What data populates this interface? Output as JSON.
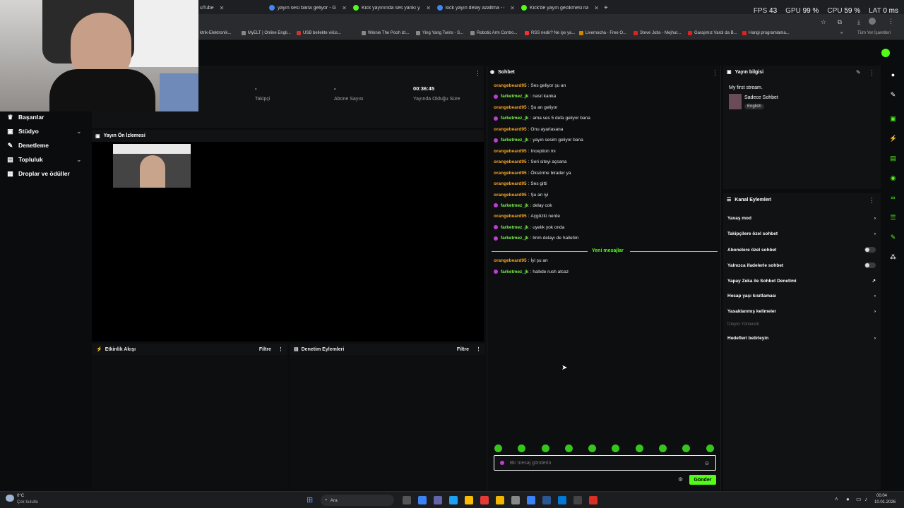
{
  "browser": {
    "tabs": [
      {
        "label": "uTube",
        "color": "#ff0000"
      },
      {
        "label": "yayın sesi bana geliyor - Googl",
        "color": "#4285f4"
      },
      {
        "label": "Kick yayınında ses yankı yapıyo",
        "color": "#53fc18"
      },
      {
        "label": "kick yayın delay azaltma - Goog",
        "color": "#4285f4"
      },
      {
        "label": "Kick'de yayın gecikmesi nasıl d",
        "color": "#53fc18"
      }
    ],
    "new_tab": "+",
    "bookmarks": [
      "ktrik-Elektronik...",
      "MyELT | Online Engli...",
      "USB bellekte virüs...",
      "Winnie The Pooh izl...",
      "Ying Yang Twins - S...",
      "Robotic Arm Contro...",
      "RSS nedir? Ne işe ya...",
      "Livemocha - Free O...",
      "Steve Jobs - Mejhur...",
      "Garajımız Vardı da B...",
      "Hangi programlama..."
    ],
    "all_bookmarks": "Tüm Yer İşaretleri"
  },
  "perf": {
    "fps_label": "FPS",
    "fps": "43",
    "gpu_label": "GPU",
    "gpu": "99 %",
    "cpu_label": "CPU",
    "cpu": "59 %",
    "lat_label": "LAT",
    "lat": "0 ms"
  },
  "sidebar": {
    "items": [
      {
        "label": "Başarılar",
        "icon": "trophy-icon"
      },
      {
        "label": "Stüdyo",
        "icon": "studio-icon"
      },
      {
        "label": "Denetleme",
        "icon": "shield-icon"
      },
      {
        "label": "Topluluk",
        "icon": "community-icon"
      },
      {
        "label": "Droplar ve ödüller",
        "icon": "gift-icon"
      }
    ]
  },
  "stats": {
    "followers_value": "-",
    "followers_label": "Takipçi",
    "subs_value": "-",
    "subs_label": "Abone Sayısı",
    "uptime_value": "00:36:45",
    "uptime_label": "Yayında Olduğu Süre"
  },
  "preview": {
    "title": "Yayın Ön İzlemesi"
  },
  "activity": {
    "title": "Etkinlik Akışı",
    "filter": "Filtre"
  },
  "moderation": {
    "title": "Denetim Eylemleri",
    "filter": "Filtre"
  },
  "chat": {
    "title": "Sohbet",
    "messages": [
      {
        "user": "orangebeard95",
        "type": "orange",
        "text": "Ses geliyor şu an"
      },
      {
        "user": "farketmez_jk",
        "type": "green",
        "text": "nasıl kanka"
      },
      {
        "user": "orangebeard95",
        "type": "orange",
        "text": "Şu an geliyor"
      },
      {
        "user": "farketmez_jk",
        "type": "green",
        "text": "ama ses 5 defa geliyor bana"
      },
      {
        "user": "orangebeard95",
        "type": "orange",
        "text": "Onu ayarlasana"
      },
      {
        "user": "farketmez_jk",
        "type": "green",
        "text": "yayın sesim geliyor bana"
      },
      {
        "user": "orangebeard95",
        "type": "orange",
        "text": "Inception mı"
      },
      {
        "user": "orangebeard95",
        "type": "orange",
        "text": "Seri siteyi açsana"
      },
      {
        "user": "orangebeard95",
        "type": "orange",
        "text": "Öksürme birader ya"
      },
      {
        "user": "orangebeard95",
        "type": "orange",
        "text": "Ses gitti"
      },
      {
        "user": "orangebeard95",
        "type": "orange",
        "text": "Şu an iyi"
      },
      {
        "user": "farketmez_jk",
        "type": "green",
        "text": "delay cok"
      },
      {
        "user": "orangebeard95",
        "type": "orange",
        "text": "Açgözlü nerde"
      },
      {
        "user": "farketmez_jk",
        "type": "green",
        "text": "uyelık yok onda"
      },
      {
        "user": "farketmez_jk",
        "type": "green",
        "text": "tmm delayı de halletim"
      }
    ],
    "new_messages_label": "Yeni mesajlar",
    "new_messages": [
      {
        "user": "orangebeard95",
        "type": "orange",
        "text": "İyi şu an"
      },
      {
        "user": "farketmez_jk",
        "type": "green",
        "text": "hallıde rush atcaz"
      }
    ],
    "input_placeholder": "Bir mesaj gönderin",
    "send_label": "Gönder"
  },
  "stream_info": {
    "title": "Yayın bilgisi",
    "stream_title": "My first stream.",
    "category": "Sadece Sohbet",
    "language": "English"
  },
  "channel_actions": {
    "title": "Kanal Eylemleri",
    "items": [
      {
        "label": "Yavaş mod",
        "control": "chevron"
      },
      {
        "label": "Takipçilere özel sohbet",
        "control": "chevron"
      },
      {
        "label": "Abonelere özel sohbet",
        "control": "toggle"
      },
      {
        "label": "Yalnızca ifadelerle sohbet",
        "control": "toggle"
      },
      {
        "label": "Yapay Zeka ile Sohbet Denetimi",
        "control": "external"
      },
      {
        "label": "Hesap yaşı kısıtlaması",
        "control": "chevron"
      },
      {
        "label": "Yasaklanmış kelimeler",
        "control": "chevron"
      }
    ],
    "section_label": "İzleyici Yönlendir",
    "goals": "Hedefleri belirleyin"
  },
  "taskbar": {
    "weather_temp": "0°C",
    "weather_desc": "Çok bulutlu",
    "search": "Ara",
    "time": "00:04",
    "date": "10.01.2026"
  },
  "colors": {
    "accent": "#53fc18",
    "orange_user": "#f5a623",
    "green_user": "#7cf04a"
  }
}
